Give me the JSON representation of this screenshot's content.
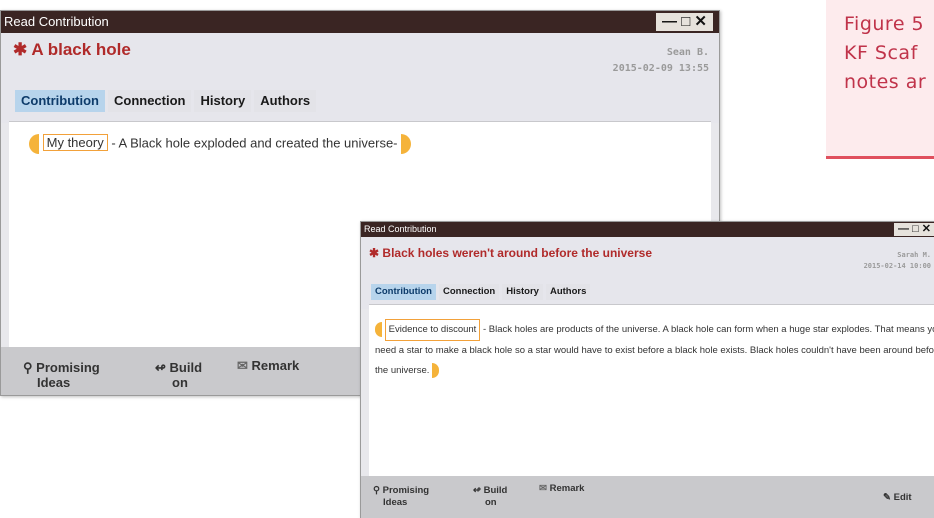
{
  "caption": {
    "lines": [
      "Figure 5",
      "KF Scaf",
      "notes ar"
    ]
  },
  "colors": {
    "titlebar": "#3a2523",
    "title_red": "#b02a2a",
    "tab_active": "#b7d4ec",
    "scaffold_orange": "#f5b33a",
    "caption_bg": "#fdebed",
    "caption_border": "#e0505e"
  },
  "window1": {
    "window_title": "Read Contribution",
    "controls": {
      "minimize": "—",
      "maximize": "□",
      "close": "✕"
    },
    "note_title": "A black hole",
    "author": "Sean B.",
    "date": "2015-02-09 13:55",
    "tabs": [
      "Contribution",
      "Connection",
      "History",
      "Authors"
    ],
    "active_tab": "Contribution",
    "scaffold": "My theory",
    "body": "- A Black hole exploded and created the universe-",
    "footer": {
      "promising": [
        "Promising",
        "Ideas"
      ],
      "build": [
        "Build",
        "on"
      ],
      "remark": "Remark"
    }
  },
  "window2": {
    "window_title": "Read Contribution",
    "controls": {
      "minimize": "—",
      "maximize": "□",
      "close": "✕"
    },
    "note_title": "Black holes weren't around before the universe",
    "author": "Sarah M.",
    "date": "2015-02-14 10:00",
    "tabs": [
      "Contribution",
      "Connection",
      "History",
      "Authors"
    ],
    "active_tab": "Contribution",
    "scaffold": "Evidence to discount",
    "body": " - Black holes are products of the universe. A black hole can form when a huge star explodes. That means you need a star to make a black hole so a star would have to exist before a black hole exists. Black holes couldn't have been around before the universe.",
    "footer": {
      "promising": [
        "Promising",
        "Ideas"
      ],
      "build": [
        "Build",
        "on"
      ],
      "remark": "Remark",
      "edit": "Edit"
    }
  }
}
